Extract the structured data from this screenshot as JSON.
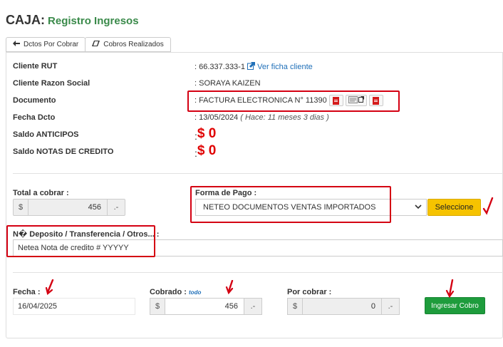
{
  "header": {
    "title": "CAJA:",
    "subtitle": "Registro Ingresos"
  },
  "tabs": [
    {
      "label": "Dctos Por Cobrar",
      "icon": "arrow-left-icon"
    },
    {
      "label": "Cobros Realizados",
      "icon": "eraser-icon"
    }
  ],
  "info": {
    "rut_label": "Cliente RUT",
    "rut_value": "66.337.333-1",
    "rut_link": "Ver ficha cliente",
    "razon_label": "Cliente Razon Social",
    "razon_value": "SORAYA KAIZEN",
    "doc_label": "Documento",
    "doc_value": "FACTURA ELECTRONICA N° 11390",
    "fecha_label": "Fecha Dcto",
    "fecha_value": "13/05/2024",
    "fecha_note": "( Hace: 11 meses 3 dias )",
    "anticipos_label": "Saldo ANTICIPOS",
    "anticipos_value": "$ 0",
    "nc_label": "Saldo NOTAS DE CREDITO",
    "nc_value": "$ 0",
    "colon": ":"
  },
  "payment": {
    "total_label": "Total a cobrar :",
    "currency": "$",
    "total_value": "456",
    "dec_suffix": ".-",
    "forma_label": "Forma de Pago :",
    "forma_selected": "NETEO DOCUMENTOS VENTAS IMPORTADOS",
    "select_button": "Seleccione",
    "deposito_label": "N� Deposito / Transferencia / Otros... :",
    "deposito_value": "Netea Nota de credito # YYYYY"
  },
  "cobro": {
    "fecha_label": "Fecha :",
    "fecha_value": "16/04/2025",
    "cobrado_label": "Cobrado :",
    "todo_link": "todo",
    "cobrado_value": "456",
    "porcobrar_label": "Por cobrar :",
    "porcobrar_value": "0",
    "ingresar_button": "Ingresar Cobro"
  },
  "colors": {
    "accent_green": "#1e9c3c",
    "subtitle_green": "#3a8a4a",
    "highlight_red": "#d40012",
    "button_yellow": "#f6c300",
    "link_blue": "#1f6fb8"
  }
}
